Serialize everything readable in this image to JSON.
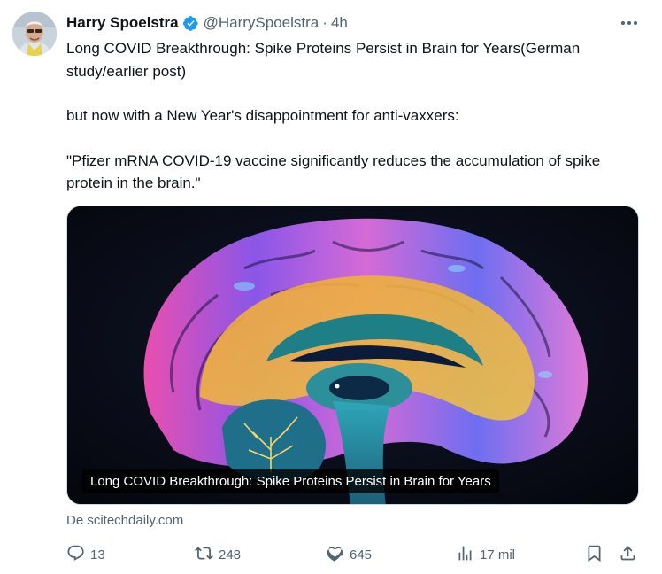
{
  "tweet": {
    "author": {
      "name": "Harry Spoelstra",
      "handle": "@HarrySpoelstra",
      "time": "4h",
      "separator": "·"
    },
    "paragraphs": [
      "Long COVID Breakthrough: Spike Proteins Persist in Brain for Years(German study/earlier post)",
      "but now with a New Year's disappointment for anti-vaxxers:",
      "\"Pfizer mRNA COVID-19 vaccine significantly reduces the accumulation of spike protein in the brain.\""
    ],
    "card": {
      "title": "Long COVID Breakthrough: Spike Proteins Persist in Brain for Years",
      "source": "De scitechdaily.com"
    },
    "actions": {
      "replies": "13",
      "reposts": "248",
      "likes": "645",
      "views": "17 mil"
    },
    "icons": {
      "verified": "verified-badge-icon",
      "more": "more-options-icon",
      "reply": "reply-icon",
      "repost": "repost-icon",
      "like": "like-icon",
      "views": "views-icon",
      "bookmark": "bookmark-icon",
      "share": "share-icon"
    },
    "colors": {
      "verified": "#1d9bf0",
      "secondary_text": "#536471",
      "primary_text": "#0f1419"
    }
  }
}
